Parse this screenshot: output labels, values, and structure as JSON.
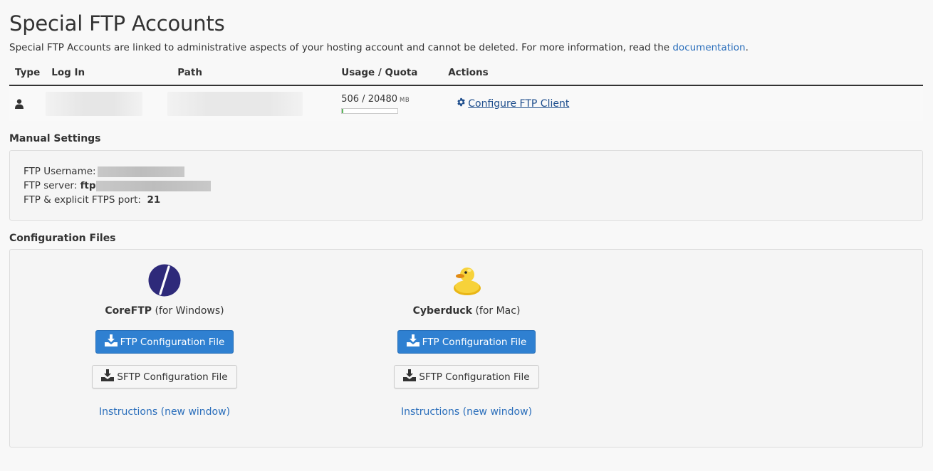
{
  "page": {
    "title": "Special FTP Accounts",
    "intro_text": "Special FTP Accounts are linked to administrative aspects of your hosting account and cannot be deleted. For more information, read the ",
    "doc_link": "documentation",
    "intro_end": "."
  },
  "table": {
    "headers": [
      "Type",
      "Log In",
      "Path",
      "Usage / Quota",
      "Actions"
    ],
    "row": {
      "type_icon": "user-icon",
      "usage": "506 / 20480",
      "usage_unit": "MB",
      "usage_fraction": 0.0247,
      "action_label": " Configure FTP Client",
      "action_icon": "gear-icon"
    }
  },
  "manual": {
    "title": "Manual Settings",
    "username_label": "FTP Username:",
    "server_label": "FTP server:",
    "server_value": "ftp",
    "port_label": "FTP & explicit FTPS port:",
    "port_value": "21"
  },
  "config": {
    "title": "Configuration Files",
    "clients": [
      {
        "name": "CoreFTP",
        "platform": "(for Windows)",
        "ftp_label": "FTP Configuration File",
        "sftp_label": "SFTP Configuration File",
        "instructions": "Instructions (new window)"
      },
      {
        "name": "Cyberduck",
        "platform": "(for Mac)",
        "ftp_label": "FTP Configuration File",
        "sftp_label": "SFTP Configuration File",
        "instructions": "Instructions (new window)"
      }
    ]
  },
  "colors": {
    "primary": "#2f80d1",
    "link": "#2a6ebb",
    "progress": "#5cb85c",
    "coreftp_logo": "#2e2a7a",
    "cyberduck_logo": "#f2c21a"
  }
}
